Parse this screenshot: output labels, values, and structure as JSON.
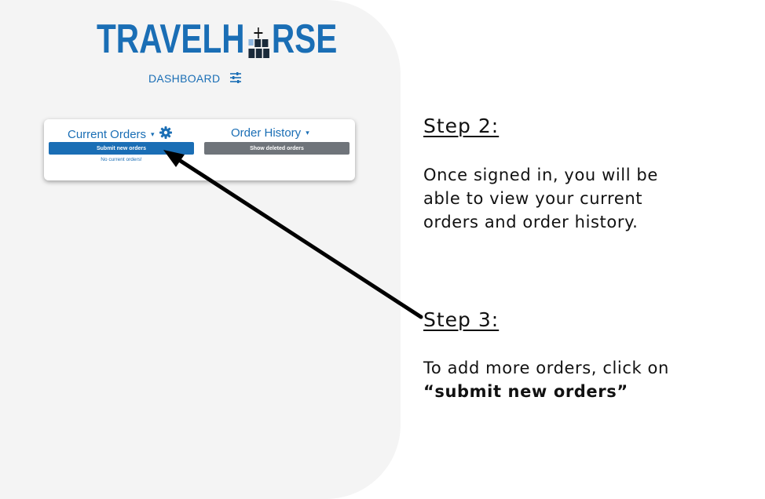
{
  "app": {
    "logo_left": "TRAVELH",
    "logo_right": "RSE",
    "brand_color": "#1a6eb5"
  },
  "nav": {
    "dashboard_label": "DASHBOARD",
    "menu_icon": "sliders-icon"
  },
  "orders": {
    "current": {
      "title": "Current Orders",
      "caret": "▾",
      "settings_icon": "gear-icon",
      "button_label": "Submit new orders",
      "empty_text": "No current orders!"
    },
    "history": {
      "title": "Order History",
      "caret": "▾",
      "button_label": "Show deleted orders"
    }
  },
  "instructions": {
    "step2": {
      "heading": "Step 2:",
      "lines": [
        "Once signed in, you will be",
        "able to view your current",
        "orders and order history."
      ]
    },
    "step3": {
      "heading": "Step 3:",
      "line1": "To add more orders, click on",
      "highlight": "“submit new orders”"
    }
  },
  "colors": {
    "button_primary": "#1a6eb5",
    "button_secondary": "#6f747a",
    "panel_bg": "#f4f4f4"
  }
}
